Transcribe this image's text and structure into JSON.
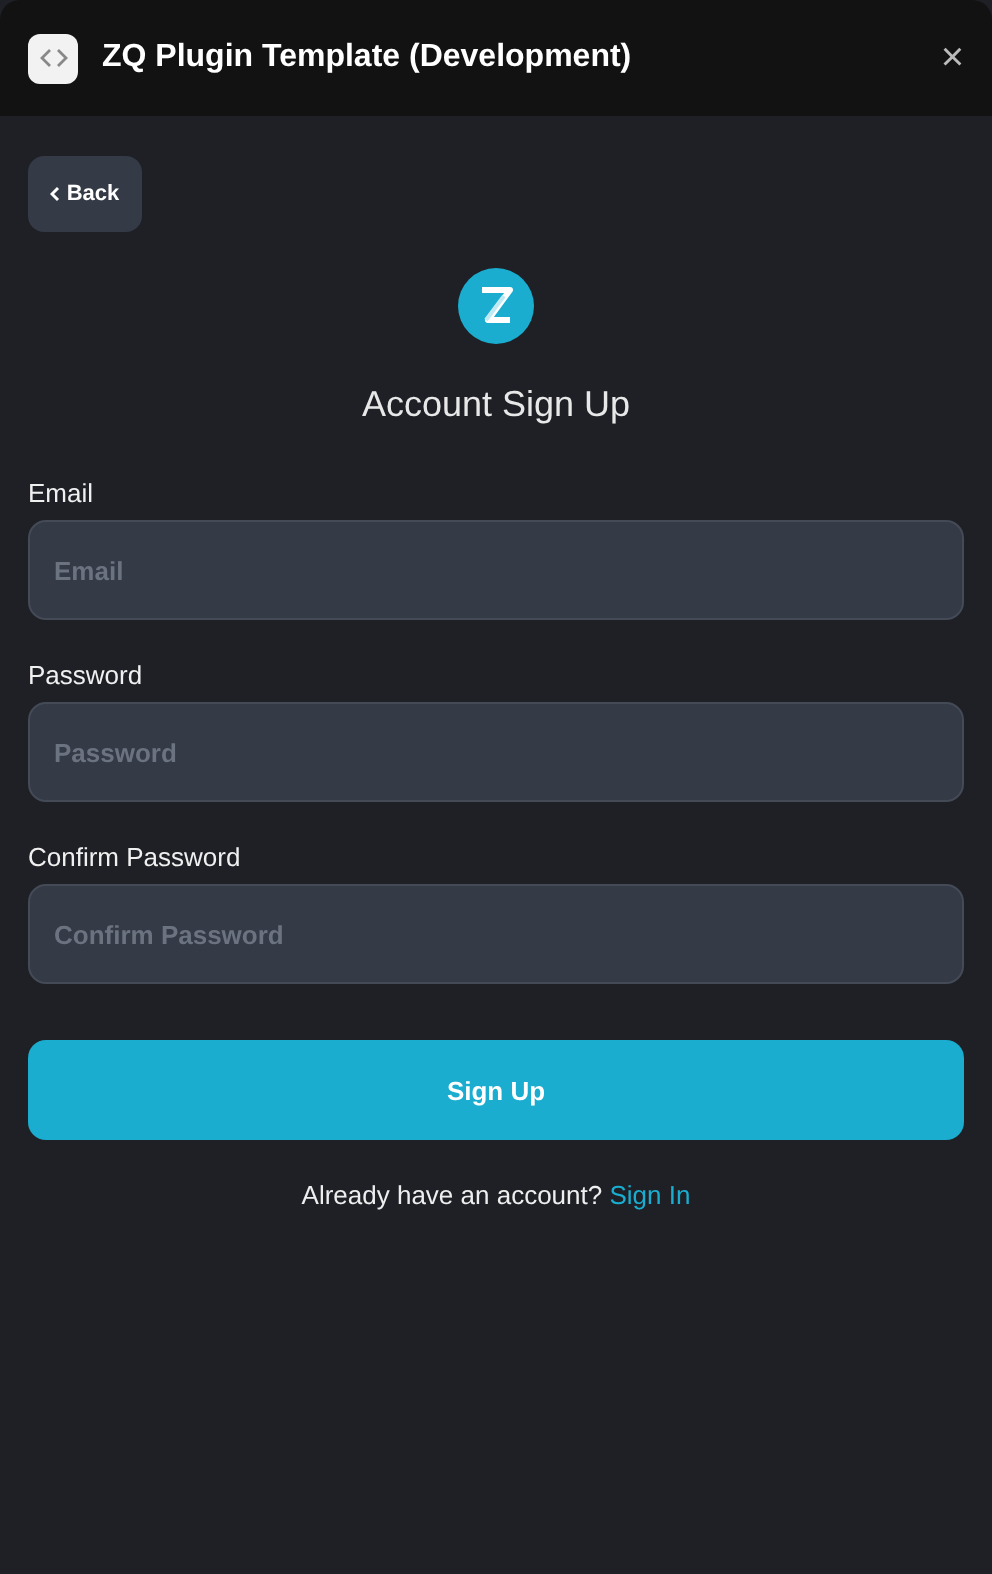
{
  "window": {
    "title": "ZQ Plugin Template (Development)",
    "close": "×"
  },
  "back_button": {
    "label": "Back"
  },
  "heading": "Account Sign Up",
  "fields": [
    {
      "label": "Email",
      "placeholder": "Email"
    },
    {
      "label": "Password",
      "placeholder": "Password"
    },
    {
      "label": "Confirm Password",
      "placeholder": "Confirm Password"
    }
  ],
  "submit_button": {
    "label": "Sign Up"
  },
  "footer": {
    "prompt": "Already have an account?",
    "link": "Sign In"
  }
}
